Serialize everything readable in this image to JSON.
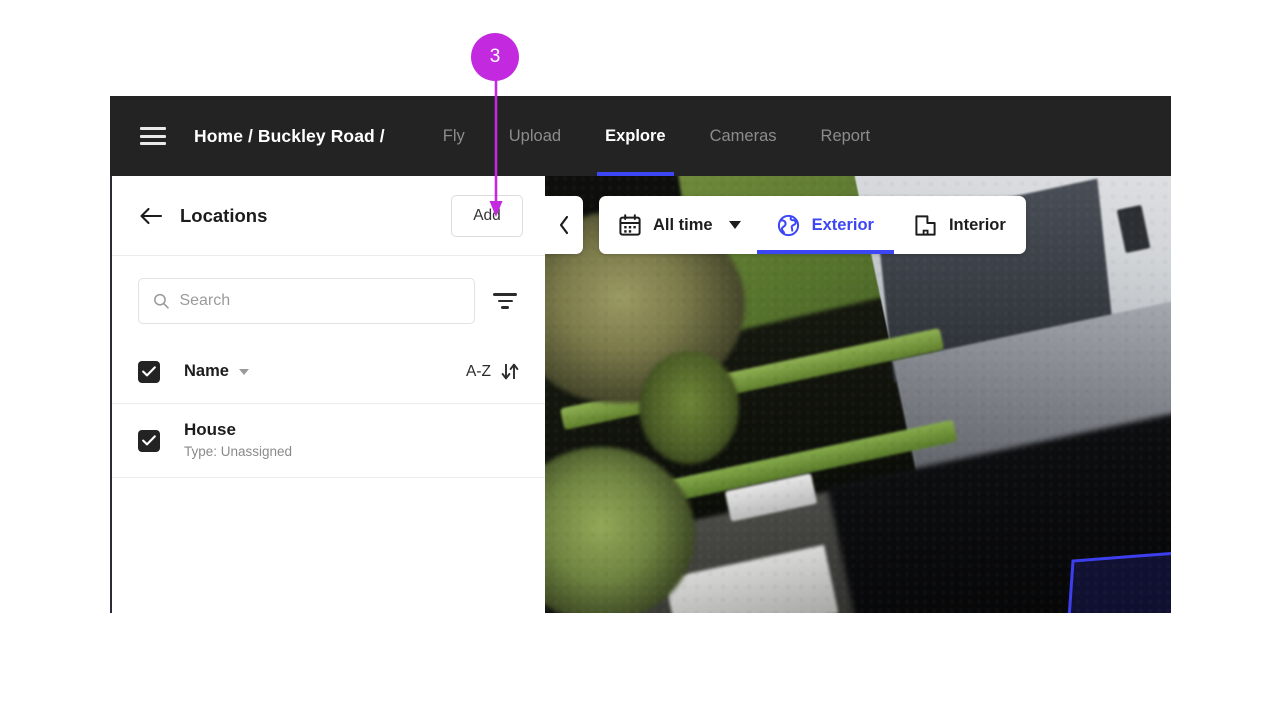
{
  "annotation": {
    "badge_number": "3",
    "badge_color": "#c32ae0",
    "points_to": "add-button"
  },
  "topnav": {
    "menu_icon": "hamburger-icon",
    "breadcrumb": "Home / Buckley Road /",
    "tabs": [
      {
        "label": "Fly",
        "active": false
      },
      {
        "label": "Upload",
        "active": false
      },
      {
        "label": "Explore",
        "active": true
      },
      {
        "label": "Cameras",
        "active": false
      },
      {
        "label": "Report",
        "active": false
      }
    ],
    "active_tab": "Explore",
    "background": "#232323",
    "accent": "#3d46f5"
  },
  "sidebar": {
    "back_icon": "back-arrow-icon",
    "title": "Locations",
    "add_label": "Add",
    "search": {
      "icon": "search-icon",
      "placeholder": "Search",
      "value": ""
    },
    "filter_icon": "filter-icon",
    "header_row": {
      "checkbox_checked": true,
      "column_label": "Name",
      "dropdown_icon": "chevron-down-icon",
      "sort_label": "A-Z",
      "sort_icon": "sort-arrows-icon"
    },
    "items": [
      {
        "checked": true,
        "name": "House",
        "subtitle": "Type: Unassigned"
      }
    ]
  },
  "viewer": {
    "collapse_icon": "chevron-left-icon",
    "toolbar": {
      "date_filter": {
        "icon": "calendar-icon",
        "label": "All time",
        "caret": "caret-down-icon"
      },
      "view_tabs": [
        {
          "label": "Exterior",
          "icon": "globe-icon",
          "active": true
        },
        {
          "label": "Interior",
          "icon": "floorplan-icon",
          "active": false
        }
      ],
      "active_view": "Exterior",
      "accent": "#3d46f5"
    },
    "overlay": {
      "shape": "annotation-polygon",
      "color": "#3d3ef0"
    },
    "image_description": "aerial drone photo of a house roof, lawn, hedges and driveway"
  }
}
